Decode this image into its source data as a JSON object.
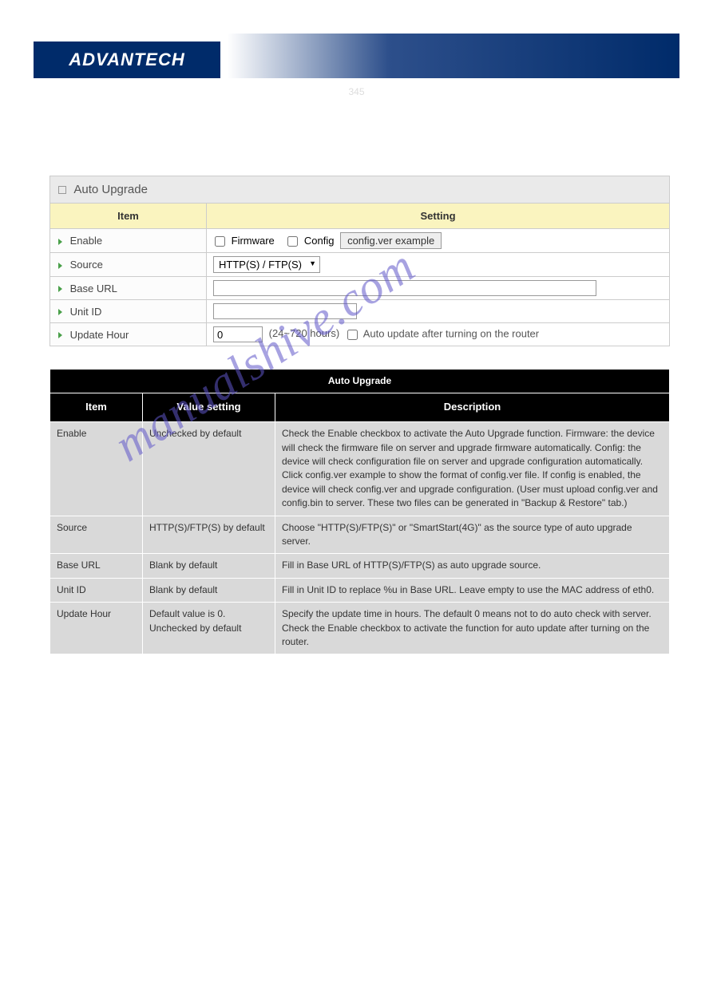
{
  "brand": "ADVANTECH",
  "page_number_display": "345",
  "watermark_text": "manualshive.com",
  "ui_panel": {
    "title": "Auto Upgrade",
    "columns": {
      "item": "Item",
      "setting": "Setting"
    },
    "rows": {
      "enable": {
        "label": "Enable",
        "firmware_label": "Firmware",
        "config_label": "Config",
        "example_btn": "config.ver example"
      },
      "source": {
        "label": "Source",
        "select_value": "HTTP(S) / FTP(S)"
      },
      "base_url": {
        "label": "Base URL",
        "value": ""
      },
      "unit_id": {
        "label": "Unit ID",
        "value": ""
      },
      "update_hour": {
        "label": "Update Hour",
        "value": "0",
        "range_note": "(24~720 hours)",
        "auto_note": "Auto update after turning on the router"
      }
    }
  },
  "doc_table": {
    "title": "Auto Upgrade",
    "columns": {
      "item": "Item",
      "value": "Value setting",
      "desc": "Description"
    },
    "rows": [
      {
        "item": "Enable",
        "value": "Unchecked by default",
        "desc": "Check the Enable checkbox to activate the Auto Upgrade function.\nFirmware: the device will check the firmware file on server and upgrade firmware automatically.\nConfig: the device will check configuration file on server and upgrade configuration automatically.\nClick config.ver example to show the format of config.ver file.\nIf config is enabled, the device will check config.ver and upgrade configuration. (User must upload config.ver and config.bin to server. These two files can be generated in \"Backup & Restore\" tab.)"
      },
      {
        "item": "Source",
        "value": "HTTP(S)/FTP(S) by default",
        "desc": "Choose \"HTTP(S)/FTP(S)\" or \"SmartStart(4G)\" as the source type of auto upgrade server."
      },
      {
        "item": "Base URL",
        "value": "Blank by default",
        "desc": "Fill in Base URL of HTTP(S)/FTP(S) as auto upgrade source."
      },
      {
        "item": "Unit ID",
        "value": "Blank by default",
        "desc": "Fill in Unit ID to replace %u in Base URL.\nLeave empty to use the MAC address of eth0."
      },
      {
        "item": "Update Hour",
        "value": "Default value is 0.\nUnchecked by default",
        "desc": "Specify the update time in hours.\nThe default 0 means not to do auto check with server.\nCheck the Enable checkbox to activate the function for auto update after turning on the router."
      }
    ]
  }
}
